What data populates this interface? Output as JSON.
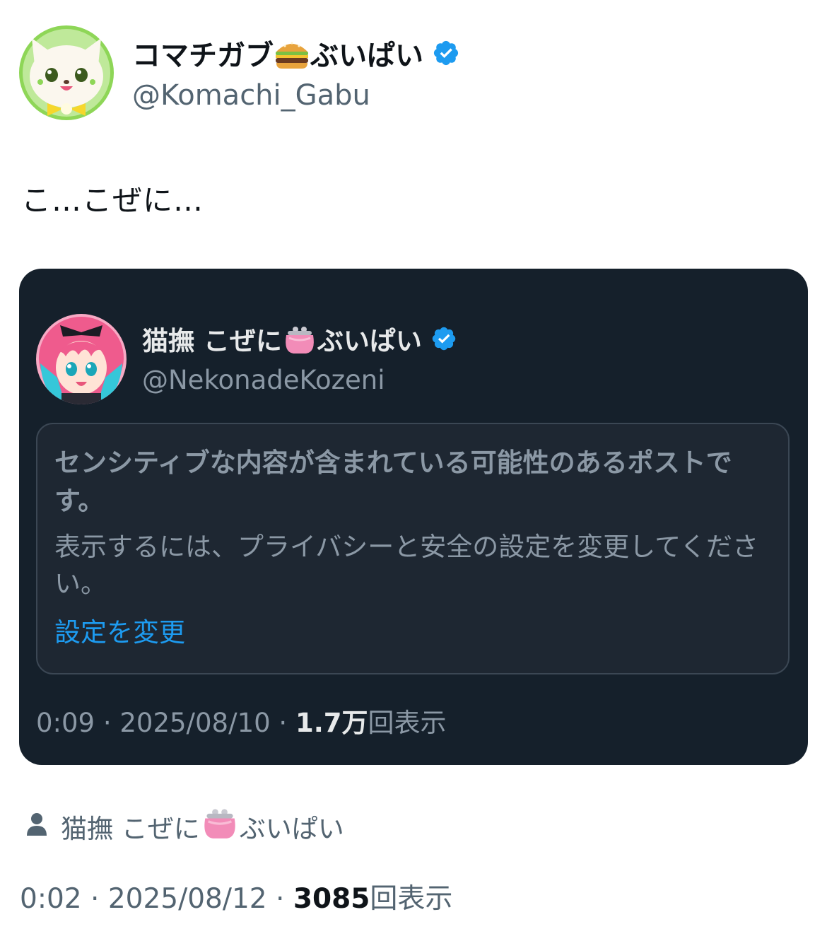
{
  "post": {
    "author": {
      "display_name_before": "コマチガブ",
      "display_name_emoji": "hamburger-emoji",
      "display_name_after": "ぶいぱい",
      "handle": "@Komachi_Gabu",
      "verified": true,
      "avatar": "white-fox-character-avatar"
    },
    "text": "こ…こぜに…",
    "quoted_post": {
      "author": {
        "display_name_before": "猫撫 こぜに",
        "display_name_emoji": "purse-emoji",
        "display_name_after": "ぶいぱい",
        "handle": "@NekonadeKozeni",
        "verified": true,
        "avatar": "pink-haired-anime-girl-avatar"
      },
      "notice": {
        "title": "センシティブな内容が含まれている可能性のあるポストです。",
        "body": "表示するには、プライバシーと安全の設定を変更してください。",
        "link": "設定を変更"
      },
      "time": "0:09",
      "date": "2025/08/10",
      "views_count": "1.7万",
      "views_label": "回表示",
      "separator": "·"
    },
    "reposted_by": {
      "name_before": "猫撫 こぜに",
      "name_emoji": "purse-emoji",
      "name_after": "ぶいぱい",
      "icon": "person-icon"
    },
    "time": "0:02",
    "date": "2025/08/12",
    "views_count": "3085",
    "views_label": "回表示",
    "separator": "·"
  },
  "colors": {
    "verified_blue": "#1d9bf0",
    "card_bg": "#15202b",
    "link_blue": "#1d9bf0",
    "muted_text": "#536471"
  }
}
